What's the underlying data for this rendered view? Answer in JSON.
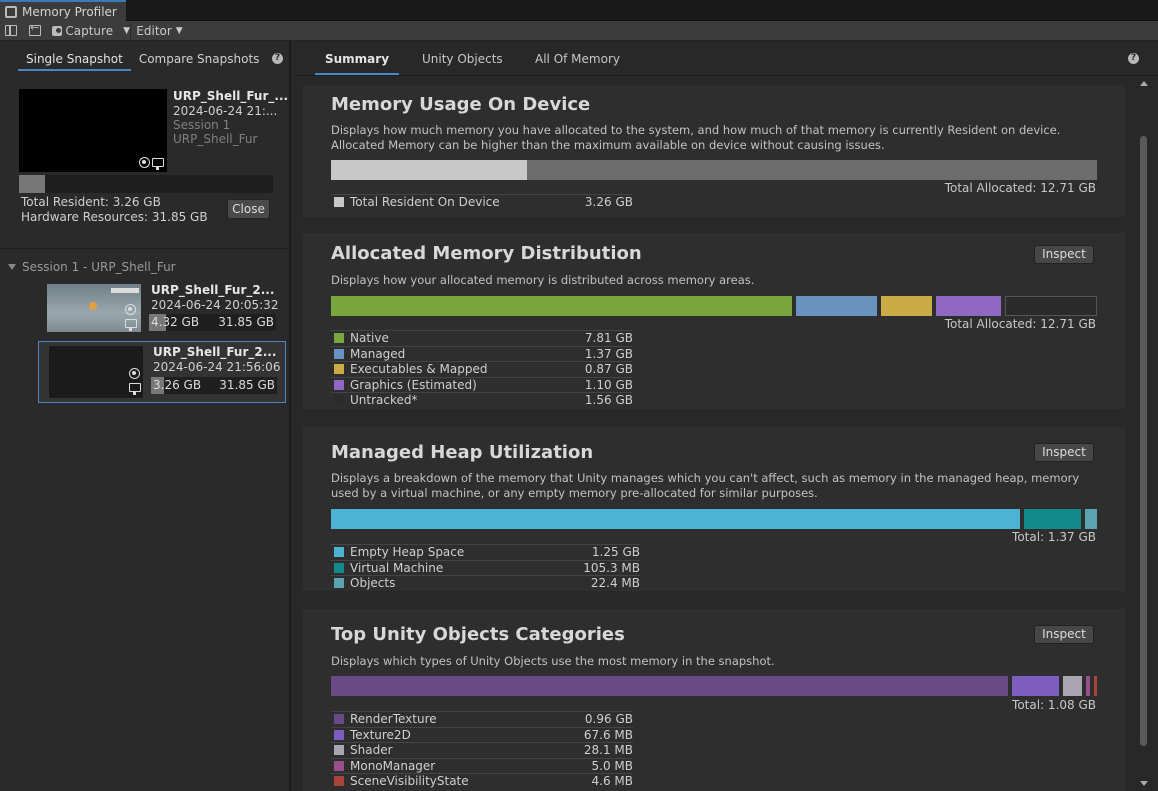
{
  "window": {
    "title": "Memory Profiler"
  },
  "toolbar": {
    "capture_label": "Capture",
    "editor_label": "Editor"
  },
  "left": {
    "tabs": [
      "Single Snapshot",
      "Compare Snapshots"
    ],
    "current": {
      "name": "URP_Shell_Fur_...",
      "date": "2024-06-24 21:...",
      "session": "Session 1",
      "project": "URP_Shell_Fur",
      "total_resident": "Total Resident: 3.26 GB",
      "hardware": "Hardware Resources: 31.85 GB",
      "resident_fraction": 0.102,
      "close_label": "Close"
    },
    "session_label": "Session 1 - URP_Shell_Fur",
    "snapshots": [
      {
        "name": "URP_Shell_Fur_2...",
        "date": "2024-06-24 20:05:32",
        "used": "4.32 GB",
        "total": "31.85 GB",
        "fraction": 0.136,
        "selected": false
      },
      {
        "name": "URP_Shell_Fur_2...",
        "date": "2024-06-24 21:56:06",
        "used": "3.26 GB",
        "total": "31.85 GB",
        "fraction": 0.102,
        "selected": true
      }
    ]
  },
  "right": {
    "tabs": [
      "Summary",
      "Unity Objects",
      "All Of Memory"
    ],
    "inspect_label": "Inspect",
    "device": {
      "title": "Memory Usage On Device",
      "desc": "Displays how much memory you have allocated to the system, and how much of that memory is currently Resident on device. Allocated Memory can be higher than the maximum available on device without causing issues.",
      "total": "Total Allocated: 12.71 GB",
      "resident_fraction": 0.256,
      "legend": [
        {
          "label": "Total Resident On Device",
          "value": "3.26 GB",
          "color": "#c8c8c8"
        }
      ]
    },
    "allocated": {
      "title": "Allocated Memory Distribution",
      "desc": "Displays how your allocated memory is distributed across memory areas.",
      "total": "Total Allocated: 12.71 GB",
      "legend": [
        {
          "label": "Native",
          "value": "7.81 GB",
          "color": "#7aa63e"
        },
        {
          "label": "Managed",
          "value": "1.37 GB",
          "color": "#6893bf"
        },
        {
          "label": "Executables & Mapped",
          "value": "0.87 GB",
          "color": "#cbab45"
        },
        {
          "label": "Graphics (Estimated)",
          "value": "1.10 GB",
          "color": "#9068c4"
        },
        {
          "label": "Untracked*",
          "value": "1.56 GB",
          "color": "#2b2b2b"
        }
      ]
    },
    "heap": {
      "title": "Managed Heap Utilization",
      "desc": "Displays a breakdown of the memory that Unity manages which you can't affect, such as memory in the managed heap, memory used by a virtual machine, or any empty memory pre-allocated for similar purposes.",
      "total": "Total: 1.37 GB",
      "legend": [
        {
          "label": "Empty Heap Space",
          "value": "1.25 GB",
          "color": "#4cb3d4"
        },
        {
          "label": "Virtual Machine",
          "value": "105.3 MB",
          "color": "#138a8a"
        },
        {
          "label": "Objects",
          "value": "22.4 MB",
          "color": "#5aa3b0"
        }
      ]
    },
    "objects": {
      "title": "Top Unity Objects Categories",
      "desc": "Displays which types of Unity Objects use the most memory in the snapshot.",
      "total": "Total: 1.08 GB",
      "legend": [
        {
          "label": "RenderTexture",
          "value": "0.96 GB",
          "color": "#6a4a86"
        },
        {
          "label": "Texture2D",
          "value": "67.6 MB",
          "color": "#7c5dc0"
        },
        {
          "label": "Shader",
          "value": "28.1 MB",
          "color": "#a9a6b2"
        },
        {
          "label": "MonoManager",
          "value": "5.0 MB",
          "color": "#9a4f8d"
        },
        {
          "label": "SceneVisibilityState",
          "value": "4.6 MB",
          "color": "#a8453a"
        }
      ]
    }
  }
}
